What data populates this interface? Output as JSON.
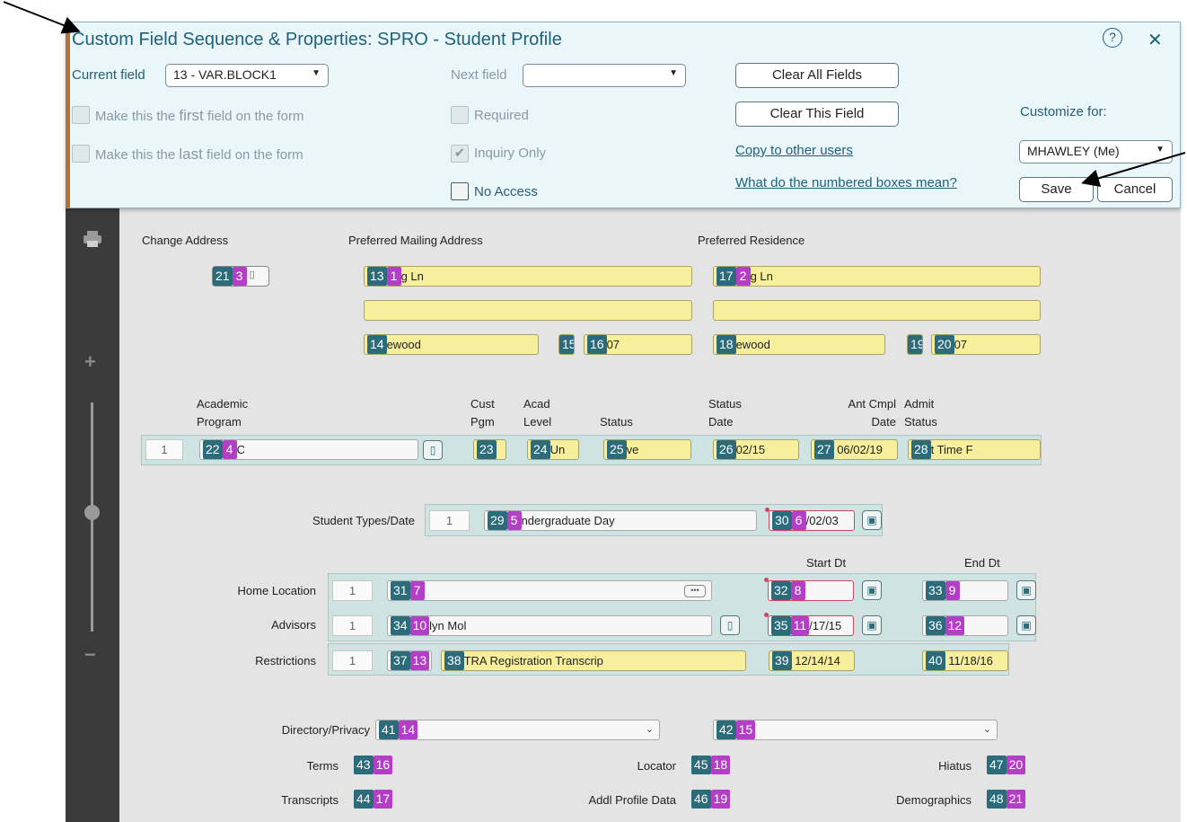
{
  "panel": {
    "title": "Custom Field Sequence & Properties: SPRO - Student Profile",
    "current_field_label": "Current field",
    "current_field_value": "13 - VAR.BLOCK1",
    "next_field_label": "Next field",
    "next_field_value": "",
    "make_first_prefix": "Make this the ",
    "make_first_word": "first",
    "make_first_suffix": " field on the form",
    "make_last_prefix": "Make this the ",
    "make_last_word": "last",
    "make_last_suffix": " field on the form",
    "required_label": "Required",
    "inquiry_only_label": "Inquiry Only",
    "no_access_label": "No Access",
    "clear_all_label": "Clear All Fields",
    "clear_this_label": "Clear This Field",
    "copy_users_label": "Copy to other users",
    "numbered_boxes_label": "What do the numbered boxes mean?",
    "customize_for_label": "Customize for:",
    "customize_for_value": "MHAWLEY (Me)",
    "save_label": "Save",
    "cancel_label": "Cancel",
    "help_icon": "?",
    "close_icon": "✕"
  },
  "address": {
    "change_address_label": "Change Address",
    "pref_mailing_label": "Preferred Mailing Address",
    "pref_residence_label": "Preferred Residence",
    "b21": "21",
    "b3": "3",
    "b13": "13",
    "b1": "1",
    "mail_line1": "g Ln",
    "b14": "14",
    "mail_city": "ewood",
    "b15": "15",
    "b16": "16",
    "mail_zip": "07",
    "b17": "17",
    "b2": "2",
    "res_line1": "g Ln",
    "b18": "18",
    "res_city": "ewood",
    "b19": "19",
    "b20": "20",
    "res_zip": "07"
  },
  "program": {
    "h_academic": "Academic",
    "h_program": "Program",
    "h_cust": "Cust",
    "h_pgm": "Pgm",
    "h_acad": "Acad",
    "h_level": "Level",
    "h_status": "Status",
    "h_status2": "Status",
    "h_date": "Date",
    "h_antcmpl": "Ant Cmpl",
    "h_date2": "Date",
    "h_admit": "Admit",
    "h_admit_status": "Status",
    "row_num": "1",
    "b22": "22",
    "b4": "4",
    "program_value": "C",
    "b23": "23",
    "b24": "24",
    "level_value": "Un",
    "b25": "25",
    "status_value": "ve",
    "b26": "26",
    "status_date_value": "02/15",
    "b27": "27",
    "ant_cmpl_value": "06/02/19",
    "b28": "28",
    "admit_status_value": "t Time F"
  },
  "student_types": {
    "label": "Student Types/Date",
    "row_num": "1",
    "b29": "29",
    "b5": "5",
    "type_value": "ndergraduate Day",
    "b30": "30",
    "b6": "6",
    "date_value": "/02/03"
  },
  "locations": {
    "start_dt_label": "Start Dt",
    "end_dt_label": "End Dt",
    "home_label": "Home Location",
    "home_row": "1",
    "b31": "31",
    "b7": "7",
    "home_value": "",
    "b32": "32",
    "b8": "8",
    "b33": "33",
    "b9": "9",
    "advisors_label": "Advisors",
    "adv_row": "1",
    "b34": "34",
    "b10": "10",
    "advisor_value": "lyn Mol",
    "b35": "35",
    "b11": "11",
    "adv_start_value": "/17/15",
    "b36": "36",
    "b12": "12",
    "restrictions_label": "Restrictions",
    "res_row": "1",
    "b37": "37",
    "b13": "13",
    "b38": "38",
    "restriction_value": "TRA Registration Transcrip",
    "b39": "39",
    "res_start_value": "12/14/14",
    "b40": "40",
    "res_end_value": "11/18/16"
  },
  "misc": {
    "dir_privacy_label": "Directory/Privacy",
    "b41": "41",
    "b14": "14",
    "b42": "42",
    "b15": "15",
    "terms_label": "Terms",
    "b43": "43",
    "b16": "16",
    "transcripts_label": "Transcripts",
    "b44": "44",
    "b17": "17",
    "locator_label": "Locator",
    "b45": "45",
    "b18": "18",
    "addl_label": "Addl Profile Data",
    "b46": "46",
    "b19": "19",
    "hiatus_label": "Hiatus",
    "b47": "47",
    "b20": "20",
    "demographics_label": "Demographics",
    "b48": "48",
    "b21": "21"
  },
  "toolbar": {
    "print_icon": "print-icon",
    "zoom_in_icon": "+",
    "zoom_out_icon": "−"
  }
}
